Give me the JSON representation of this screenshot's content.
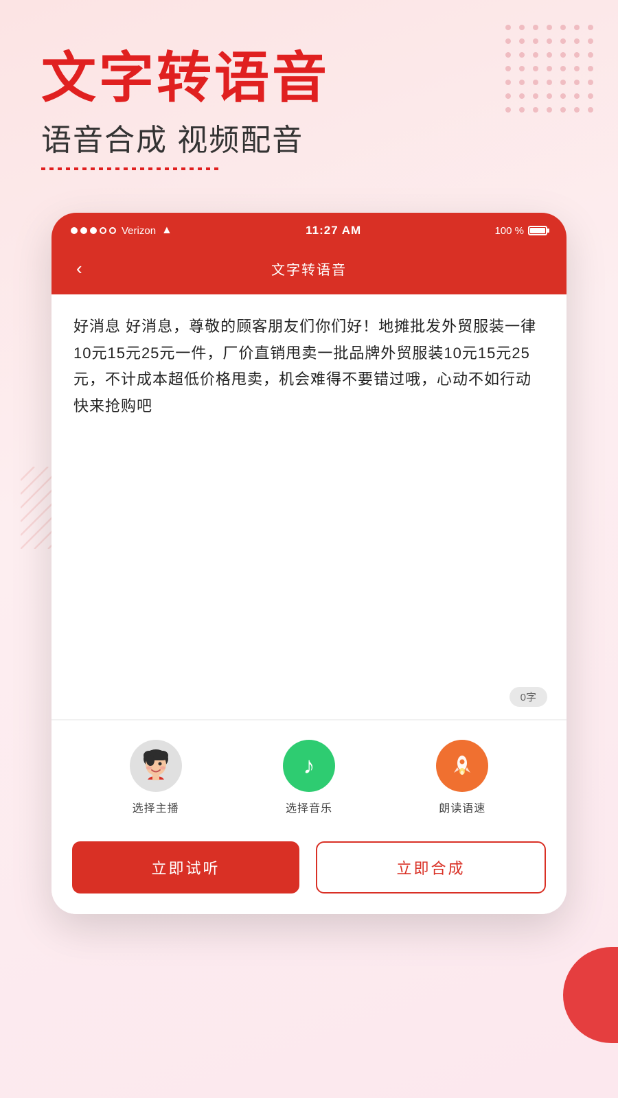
{
  "hero": {
    "title": "文字转语音",
    "subtitle": "语音合成 视频配音"
  },
  "status_bar": {
    "dots": [
      "filled",
      "filled",
      "filled",
      "empty",
      "empty"
    ],
    "carrier": "Verizon",
    "wifi": "WiFi",
    "time": "11:27 AM",
    "battery_percent": "100 %"
  },
  "nav": {
    "back_label": "‹",
    "title": "文字转语音"
  },
  "text_area": {
    "content": "好消息 好消息，尊敬的顾客朋友们你们好！地摊批发外贸服装一律10元15元25元一件，厂价直销甩卖一批品牌外贸服装10元15元25元，不计成本超低价格甩卖，机会难得不要错过哦，心动不如行动快来抢购吧",
    "char_count": "0字"
  },
  "controls": [
    {
      "id": "select-anchor",
      "icon_type": "avatar",
      "label": "选择主播"
    },
    {
      "id": "select-music",
      "icon_type": "music",
      "label": "选择音乐"
    },
    {
      "id": "reading-speed",
      "icon_type": "speed",
      "label": "朗读语速"
    }
  ],
  "actions": {
    "listen_label": "立即试听",
    "synthesize_label": "立即合成"
  }
}
